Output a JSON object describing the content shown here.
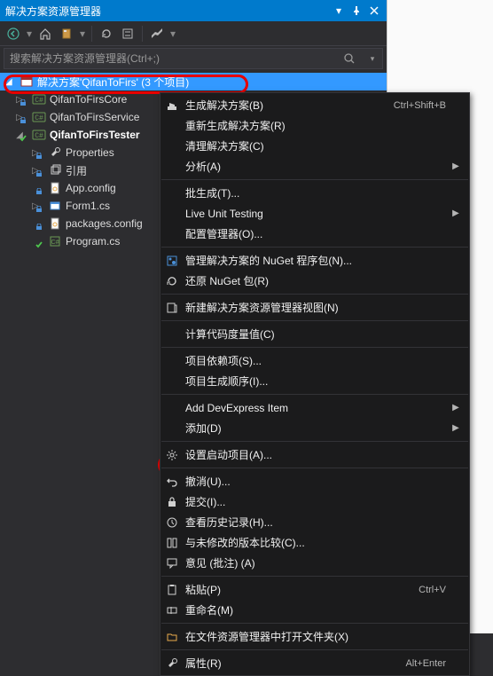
{
  "titlebar": {
    "title": "解决方案资源管理器"
  },
  "search": {
    "placeholder": "搜索解决方案资源管理器(Ctrl+;)"
  },
  "solution": {
    "label": "解决方案'QifanToFirs' (3 个项目)"
  },
  "projects": [
    {
      "label": "QifanToFirsCore",
      "bold": false,
      "expander": "▷"
    },
    {
      "label": "QifanToFirsService",
      "bold": false,
      "expander": "▷"
    },
    {
      "label": "QifanToFirsTester",
      "bold": true,
      "expander": "◢"
    }
  ],
  "tester_children": [
    {
      "label": "Properties",
      "icon": "wrench",
      "expander": "▷"
    },
    {
      "label": "引用",
      "icon": "ref",
      "expander": "▷"
    },
    {
      "label": "App.config",
      "icon": "config",
      "expander": ""
    },
    {
      "label": "Form1.cs",
      "icon": "form",
      "expander": "▷"
    },
    {
      "label": "packages.config",
      "icon": "config",
      "expander": ""
    },
    {
      "label": "Program.cs",
      "icon": "cs",
      "expander": ""
    }
  ],
  "menu": [
    {
      "icon": "build",
      "label": "生成解决方案(B)",
      "shortcut": "Ctrl+Shift+B",
      "arrow": ""
    },
    {
      "icon": "",
      "label": "重新生成解决方案(R)",
      "shortcut": "",
      "arrow": ""
    },
    {
      "icon": "",
      "label": "清理解决方案(C)",
      "shortcut": "",
      "arrow": ""
    },
    {
      "icon": "",
      "label": "分析(A)",
      "shortcut": "",
      "arrow": "▶"
    },
    {
      "sep": true
    },
    {
      "icon": "",
      "label": "批生成(T)...",
      "shortcut": "",
      "arrow": ""
    },
    {
      "icon": "",
      "label": "Live Unit Testing",
      "shortcut": "",
      "arrow": "▶"
    },
    {
      "icon": "",
      "label": "配置管理器(O)...",
      "shortcut": "",
      "arrow": ""
    },
    {
      "sep": true
    },
    {
      "icon": "nuget",
      "label": "管理解决方案的 NuGet 程序包(N)...",
      "shortcut": "",
      "arrow": ""
    },
    {
      "icon": "restore",
      "label": "还原 NuGet 包(R)",
      "shortcut": "",
      "arrow": ""
    },
    {
      "sep": true
    },
    {
      "icon": "newview",
      "label": "新建解决方案资源管理器视图(N)",
      "shortcut": "",
      "arrow": ""
    },
    {
      "sep": true
    },
    {
      "icon": "",
      "label": "计算代码度量值(C)",
      "shortcut": "",
      "arrow": ""
    },
    {
      "sep": true
    },
    {
      "icon": "",
      "label": "项目依赖项(S)...",
      "shortcut": "",
      "arrow": ""
    },
    {
      "icon": "",
      "label": "项目生成顺序(I)...",
      "shortcut": "",
      "arrow": ""
    },
    {
      "sep": true
    },
    {
      "icon": "",
      "label": "Add DevExpress Item",
      "shortcut": "",
      "arrow": "▶"
    },
    {
      "icon": "",
      "label": "添加(D)",
      "shortcut": "",
      "arrow": "▶"
    },
    {
      "sep": true
    },
    {
      "icon": "gear",
      "label": "设置启动项目(A)...",
      "shortcut": "",
      "arrow": ""
    },
    {
      "sep": true
    },
    {
      "icon": "undo",
      "label": "撤消(U)...",
      "shortcut": "",
      "arrow": ""
    },
    {
      "icon": "commit",
      "label": "提交(I)...",
      "shortcut": "",
      "arrow": ""
    },
    {
      "icon": "history",
      "label": "查看历史记录(H)...",
      "shortcut": "",
      "arrow": ""
    },
    {
      "icon": "compare",
      "label": "与未修改的版本比较(C)...",
      "shortcut": "",
      "arrow": ""
    },
    {
      "icon": "comment",
      "label": "意见 (批注) (A)",
      "shortcut": "",
      "arrow": ""
    },
    {
      "sep": true
    },
    {
      "icon": "paste",
      "label": "粘贴(P)",
      "shortcut": "Ctrl+V",
      "arrow": ""
    },
    {
      "icon": "rename",
      "label": "重命名(M)",
      "shortcut": "",
      "arrow": ""
    },
    {
      "sep": true
    },
    {
      "icon": "folder",
      "label": "在文件资源管理器中打开文件夹(X)",
      "shortcut": "",
      "arrow": ""
    },
    {
      "sep": true
    },
    {
      "icon": "wrench",
      "label": "属性(R)",
      "shortcut": "Alt+Enter",
      "arrow": ""
    }
  ]
}
